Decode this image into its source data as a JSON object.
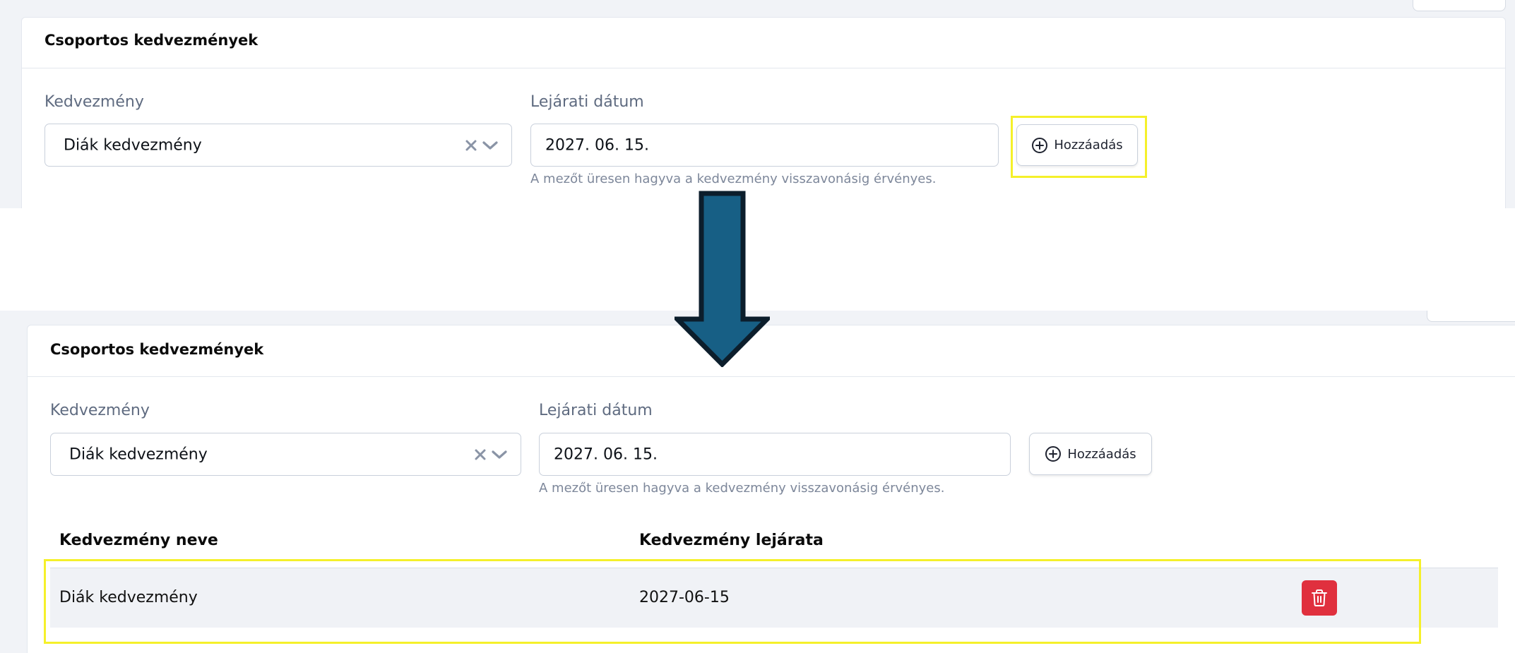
{
  "colors": {
    "page_bg": "#f1f3f7",
    "highlight": "#f5f02a",
    "arrow": "#175f85",
    "delete": "#e0303e"
  },
  "before": {
    "card_title": "Csoportos kedvezmények",
    "discount_label": "Kedvezmény",
    "discount_value": "Diák kedvezmény",
    "date_label": "Lejárati dátum",
    "date_value": "2027. 06. 15.",
    "help_text": "A mezőt üresen hagyva a kedvezmény visszavonásig érvényes.",
    "add_button_label": "Hozzáadás",
    "icons": [
      "clear-icon",
      "chevron-down-icon",
      "plus-circle-icon"
    ]
  },
  "after": {
    "card_title": "Csoportos kedvezmények",
    "discount_label": "Kedvezmény",
    "discount_value": "Diák kedvezmény",
    "date_label": "Lejárati dátum",
    "date_value": "2027. 06. 15.",
    "help_text": "A mezőt üresen hagyva a kedvezmény visszavonásig érvényes.",
    "add_button_label": "Hozzáadás",
    "table": {
      "columns": [
        "Kedvezmény neve",
        "Kedvezmény lejárata"
      ],
      "rows": [
        {
          "name": "Diák kedvezmény",
          "expiry": "2027-06-15",
          "action_icon": "trash-icon"
        }
      ]
    }
  }
}
